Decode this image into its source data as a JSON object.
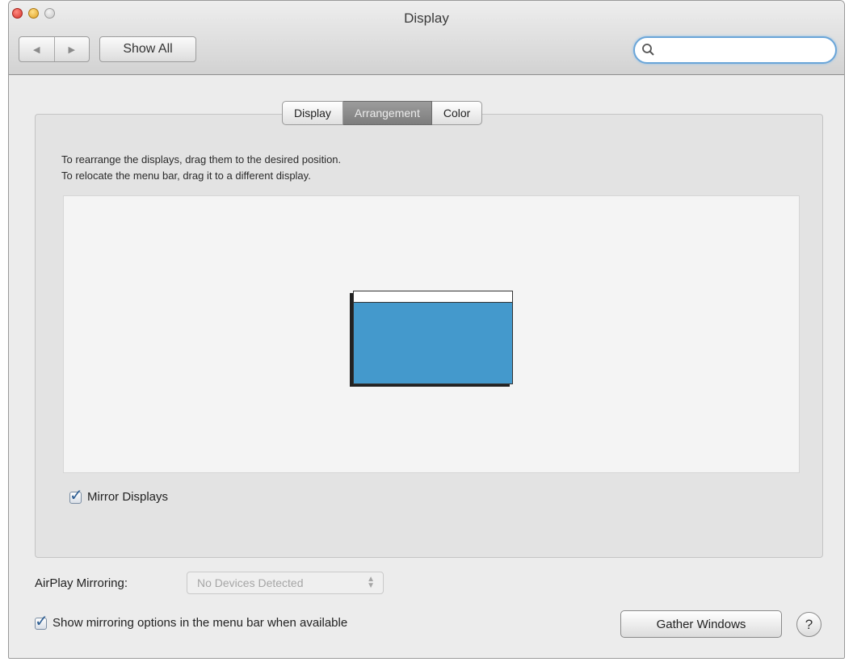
{
  "window": {
    "title": "Display"
  },
  "toolbar": {
    "back_icon": "left-arrow-icon",
    "forward_icon": "right-arrow-icon",
    "show_all_label": "Show All",
    "search_value": "",
    "search_icon": "magnifier-icon"
  },
  "tabs": [
    {
      "label": "Display",
      "selected": false
    },
    {
      "label": "Arrangement",
      "selected": true
    },
    {
      "label": "Color",
      "selected": false
    }
  ],
  "arrangement": {
    "instruction_1": "To rearrange the displays, drag them to the desired position.",
    "instruction_2": "To relocate the menu bar, drag it to a different display.",
    "display_color": "#4499cc",
    "mirror_displays_label": "Mirror Displays",
    "mirror_displays_checked": true
  },
  "airplay": {
    "label": "AirPlay Mirroring:",
    "selected_value": "No Devices Detected"
  },
  "show_mirroring": {
    "label": "Show mirroring options in the menu bar when available",
    "checked": true
  },
  "gather_windows_label": "Gather Windows",
  "help_label": "?"
}
